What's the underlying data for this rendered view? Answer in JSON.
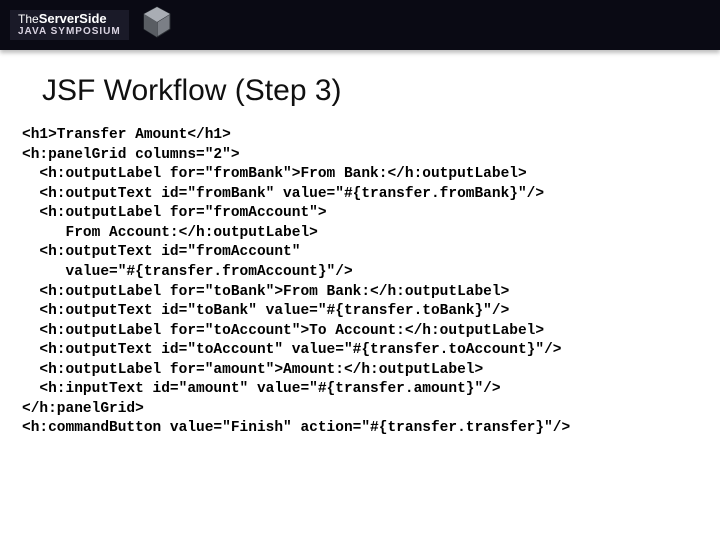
{
  "header": {
    "brand_the": "The",
    "brand_name": "ServerSide",
    "brand_sub": "JAVA SYMPOSIUM"
  },
  "slide": {
    "title": "JSF Workflow (Step 3)",
    "code": "<h1>Transfer Amount</h1>\n<h:panelGrid columns=\"2\">\n  <h:outputLabel for=\"fromBank\">From Bank:</h:outputLabel>\n  <h:outputText id=\"fromBank\" value=\"#{transfer.fromBank}\"/>\n  <h:outputLabel for=\"fromAccount\">\n     From Account:</h:outputLabel>\n  <h:outputText id=\"fromAccount\"\n     value=\"#{transfer.fromAccount}\"/>\n  <h:outputLabel for=\"toBank\">From Bank:</h:outputLabel>\n  <h:outputText id=\"toBank\" value=\"#{transfer.toBank}\"/>\n  <h:outputLabel for=\"toAccount\">To Account:</h:outputLabel>\n  <h:outputText id=\"toAccount\" value=\"#{transfer.toAccount}\"/>\n  <h:outputLabel for=\"amount\">Amount:</h:outputLabel>\n  <h:inputText id=\"amount\" value=\"#{transfer.amount}\"/>\n</h:panelGrid>\n<h:commandButton value=\"Finish\" action=\"#{transfer.transfer}\"/>"
  }
}
